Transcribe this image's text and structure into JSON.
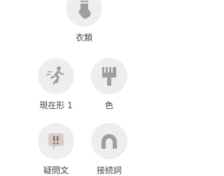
{
  "tiles": [
    {
      "label": "衣類",
      "icon": "sock-icon"
    },
    {
      "label": "現在形 1",
      "icon": "running-person-icon"
    },
    {
      "label": "色",
      "icon": "paintbrush-icon"
    },
    {
      "label": "疑問文",
      "icon": "question-mark-icon"
    },
    {
      "label": "接続詞",
      "icon": "arch-connector-icon"
    }
  ],
  "colors": {
    "background": "#ffffff",
    "circle": "#eeeeee",
    "icon": "#9e9e9e",
    "text": "#444444"
  }
}
